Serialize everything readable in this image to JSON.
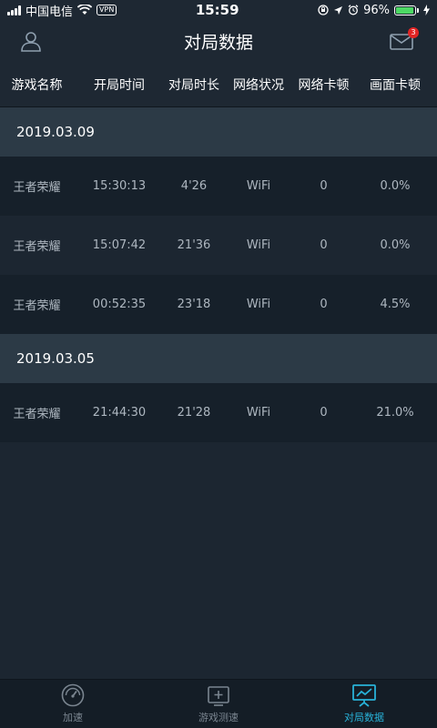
{
  "status_bar": {
    "carrier": "中国电信",
    "vpn": "VPN",
    "time": "15:59",
    "battery": "96%",
    "battery_level": 0.96
  },
  "header": {
    "title": "对局数据",
    "mail_badge": "3"
  },
  "columns": [
    "游戏名称",
    "开局时间",
    "对局时长",
    "网络状况",
    "网络卡顿",
    "画面卡顿"
  ],
  "groups": [
    {
      "date": "2019.03.09",
      "rows": [
        [
          "王者荣耀",
          "15:30:13",
          "4'26",
          "WiFi",
          "0",
          "0.0%"
        ],
        [
          "王者荣耀",
          "15:07:42",
          "21'36",
          "WiFi",
          "0",
          "0.0%"
        ],
        [
          "王者荣耀",
          "00:52:35",
          "23'18",
          "WiFi",
          "0",
          "4.5%"
        ]
      ]
    },
    {
      "date": "2019.03.05",
      "rows": [
        [
          "王者荣耀",
          "21:44:30",
          "21'28",
          "WiFi",
          "0",
          "21.0%"
        ]
      ]
    }
  ],
  "tabs": [
    {
      "label": "加速",
      "icon": "speedometer-icon"
    },
    {
      "label": "游戏测速",
      "icon": "speed-test-icon"
    },
    {
      "label": "对局数据",
      "icon": "chart-board-icon",
      "active": true
    }
  ],
  "colors": {
    "accent": "#28b2d8",
    "badge": "#e22424",
    "battery": "#4cd964"
  }
}
